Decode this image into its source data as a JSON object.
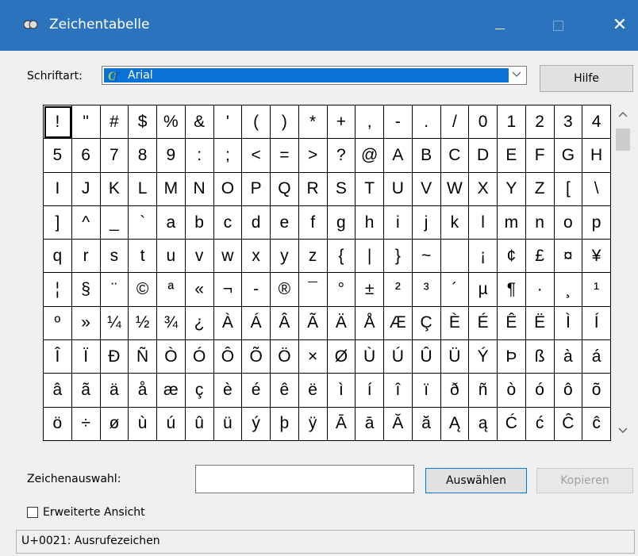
{
  "window": {
    "title": "Zeichentabelle",
    "controls": {
      "minimize": "minimize",
      "maximize": "maximize",
      "close": "✕"
    }
  },
  "font": {
    "label": "Schriftart:",
    "selected": "Arial",
    "help_button": "Hilfe"
  },
  "grid": {
    "rows": [
      [
        "!",
        "\"",
        "#",
        "$",
        "%",
        "&",
        "'",
        "(",
        ")",
        "*",
        "+",
        ",",
        "-",
        ".",
        "/",
        "0",
        "1",
        "2",
        "3",
        "4"
      ],
      [
        "5",
        "6",
        "7",
        "8",
        "9",
        ":",
        ";",
        "<",
        "=",
        ">",
        "?",
        "@",
        "A",
        "B",
        "C",
        "D",
        "E",
        "F",
        "G",
        "H"
      ],
      [
        "I",
        "J",
        "K",
        "L",
        "M",
        "N",
        "O",
        "P",
        "Q",
        "R",
        "S",
        "T",
        "U",
        "V",
        "W",
        "X",
        "Y",
        "Z",
        "[",
        "\\"
      ],
      [
        "]",
        "^",
        "_",
        "`",
        "a",
        "b",
        "c",
        "d",
        "e",
        "f",
        "g",
        "h",
        "i",
        "j",
        "k",
        "l",
        "m",
        "n",
        "o",
        "p"
      ],
      [
        "q",
        "r",
        "s",
        "t",
        "u",
        "v",
        "w",
        "x",
        "y",
        "z",
        "{",
        "|",
        "}",
        "~",
        "",
        "¡",
        "¢",
        "£",
        "¤",
        "¥"
      ],
      [
        "¦",
        "§",
        "¨",
        "©",
        "ª",
        "«",
        "¬",
        "-",
        "®",
        "¯",
        "°",
        "±",
        "²",
        "³",
        "´",
        "µ",
        "¶",
        "·",
        "¸",
        "¹"
      ],
      [
        "º",
        "»",
        "¼",
        "½",
        "¾",
        "¿",
        "À",
        "Á",
        "Â",
        "Ã",
        "Ä",
        "Å",
        "Æ",
        "Ç",
        "È",
        "É",
        "Ê",
        "Ë",
        "Ì",
        "Í"
      ],
      [
        "Î",
        "Ï",
        "Ð",
        "Ñ",
        "Ò",
        "Ó",
        "Ô",
        "Õ",
        "Ö",
        "×",
        "Ø",
        "Ù",
        "Ú",
        "Û",
        "Ü",
        "Ý",
        "Þ",
        "ß",
        "à",
        "á"
      ],
      [
        "â",
        "ã",
        "ä",
        "å",
        "æ",
        "ç",
        "è",
        "é",
        "ê",
        "ë",
        "ì",
        "í",
        "î",
        "ï",
        "ð",
        "ñ",
        "ò",
        "ó",
        "ô",
        "õ"
      ],
      [
        "ö",
        "÷",
        "ø",
        "ù",
        "ú",
        "û",
        "ü",
        "ý",
        "þ",
        "ÿ",
        "Ā",
        "ā",
        "Ă",
        "ă",
        "Ą",
        "ą",
        "Ć",
        "ć",
        "Ĉ",
        "ĉ"
      ]
    ]
  },
  "selection": {
    "label": "Zeichenauswahl:",
    "value": "",
    "select_button": "Auswählen",
    "copy_button": "Kopieren"
  },
  "advanced": {
    "label": "Erweiterte Ansicht",
    "checked": false
  },
  "status": {
    "text": "U+0021: Ausrufezeichen"
  }
}
